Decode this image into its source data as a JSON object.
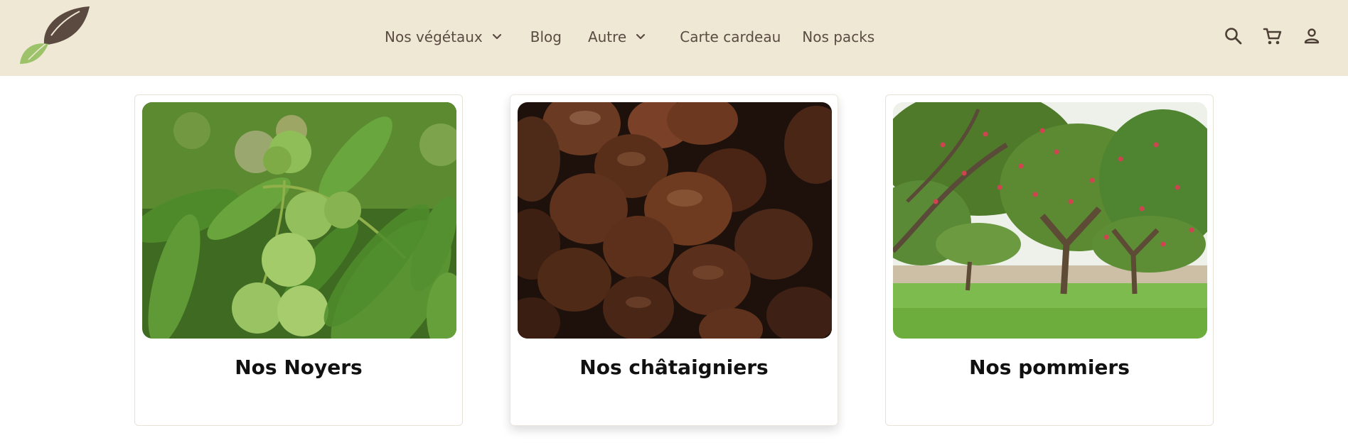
{
  "header": {
    "nav": [
      {
        "label": "Nos végétaux",
        "has_dropdown": true
      },
      {
        "label": "Blog",
        "has_dropdown": false
      },
      {
        "label": "Autre",
        "has_dropdown": true
      },
      {
        "label": "Carte cardeau",
        "has_dropdown": false
      },
      {
        "label": "Nos packs",
        "has_dropdown": false
      }
    ],
    "icons": [
      "search-icon",
      "cart-icon",
      "account-icon"
    ]
  },
  "cards": [
    {
      "title": "Nos Noyers",
      "image": "green walnuts on tree"
    },
    {
      "title": "Nos châtaigniers",
      "image": "pile of chestnuts"
    },
    {
      "title": "Nos pommiers",
      "image": "apple orchard"
    }
  ],
  "colors": {
    "header_bg": "#efe8d4",
    "nav_text": "#5a4c42",
    "leaf_brown": "#5b4a40",
    "leaf_green": "#9cc36a"
  }
}
